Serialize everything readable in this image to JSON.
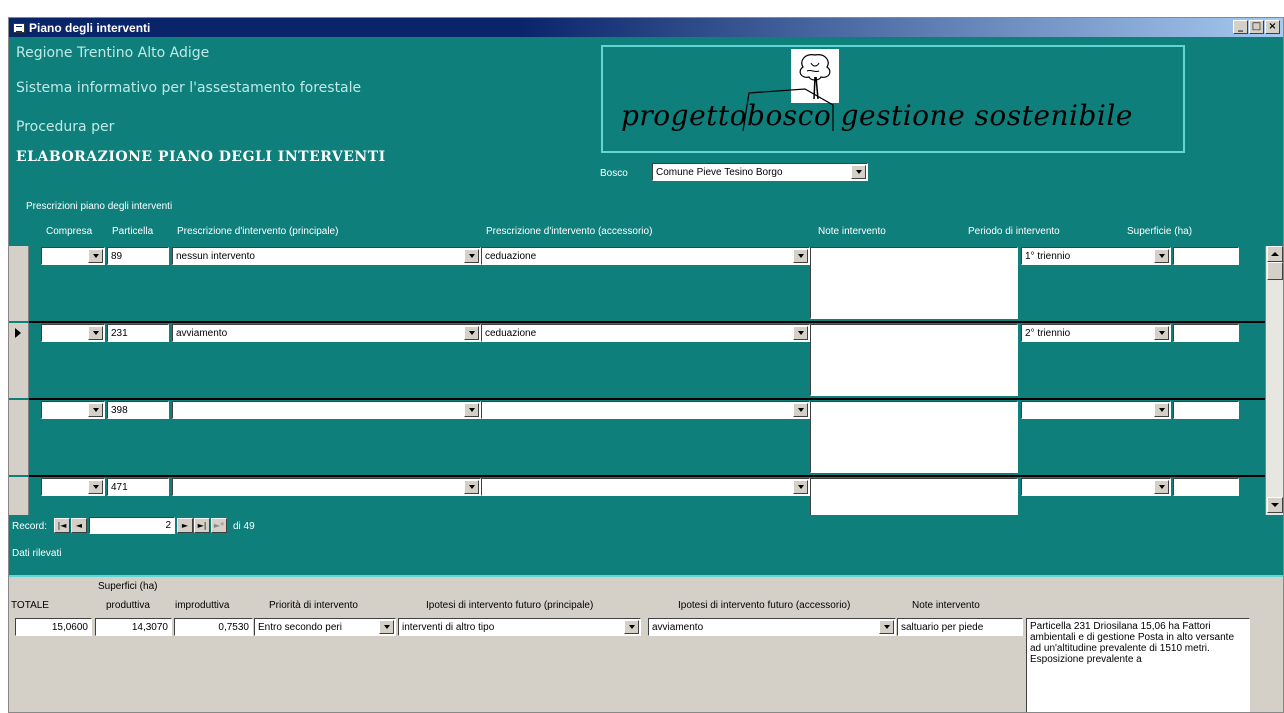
{
  "window": {
    "title": "Piano degli interventi",
    "controls": [
      "_",
      "□",
      "×"
    ]
  },
  "header": {
    "region": "Regione  Trentino Alto Adige",
    "system": "Sistema informativo per l'assestamento forestale",
    "procedure": "Procedura per",
    "title": "ELABORAZIONE PIANO DEGLI INTERVENTI"
  },
  "logo": {
    "text": "progettobosco gestione sostenibile"
  },
  "bosco": {
    "label": "Bosco",
    "value": "Comune Pieve Tesino Borgo"
  },
  "subform": {
    "caption": "Prescrizioni piano degli interventi",
    "columns": {
      "compresa": "Compresa",
      "particella": "Particella",
      "principale": "Prescrizione d'intervento  (principale)",
      "accessorio": "Prescrizione d'intervento  (accessorio)",
      "note": "Note intervento",
      "periodo": "Periodo di intervento",
      "superficie": "Superficie (ha)"
    },
    "rows": [
      {
        "compresa": "",
        "particella": "89",
        "principale": "nessun intervento",
        "accessorio": "ceduazione",
        "note": "",
        "periodo": "1° triennio",
        "superficie": "",
        "current": false
      },
      {
        "compresa": "",
        "particella": "231",
        "principale": "avviamento",
        "accessorio": "ceduazione",
        "note": "",
        "periodo": "2° triennio",
        "superficie": "",
        "current": true
      },
      {
        "compresa": "",
        "particella": "398",
        "principale": "",
        "accessorio": "",
        "note": "",
        "periodo": "",
        "superficie": "",
        "current": false
      },
      {
        "compresa": "",
        "particella": "471",
        "principale": "",
        "accessorio": "",
        "note": "",
        "periodo": "",
        "superficie": "",
        "current": false
      }
    ]
  },
  "record_nav": {
    "label": "Record:",
    "current": "2",
    "total_text": "di 49",
    "first": "|◄",
    "prev": "◄",
    "next": "►",
    "last": "►|",
    "new": "►*"
  },
  "dati": {
    "caption": "Dati rilevati",
    "superfici_label": "Superfici (ha)",
    "totale_label": "TOTALE",
    "produttiva_label": "produttiva",
    "improduttiva_label": "improduttiva",
    "priorita_label": "Priorità di intervento",
    "ipotesi_principale_label": "Ipotesi di intervento futuro (principale)",
    "ipotesi_accessorio_label": "Ipotesi di intervento futuro (accessorio)",
    "note_label": "Note intervento",
    "totale": "15,0600",
    "produttiva": "14,3070",
    "improduttiva": "0,7530",
    "priorita": "Entro secondo peri",
    "ipotesi_principale": "interventi di altro tipo",
    "ipotesi_accessorio": "avviamento",
    "note": "saltuario per piede",
    "descrizione": "Particella 231 Driosilana 15,06 ha Fattori ambientali e di gestione Posta in alto versante ad un'altitudine prevalente di 1510 metri. Esposizione prevalente a"
  }
}
